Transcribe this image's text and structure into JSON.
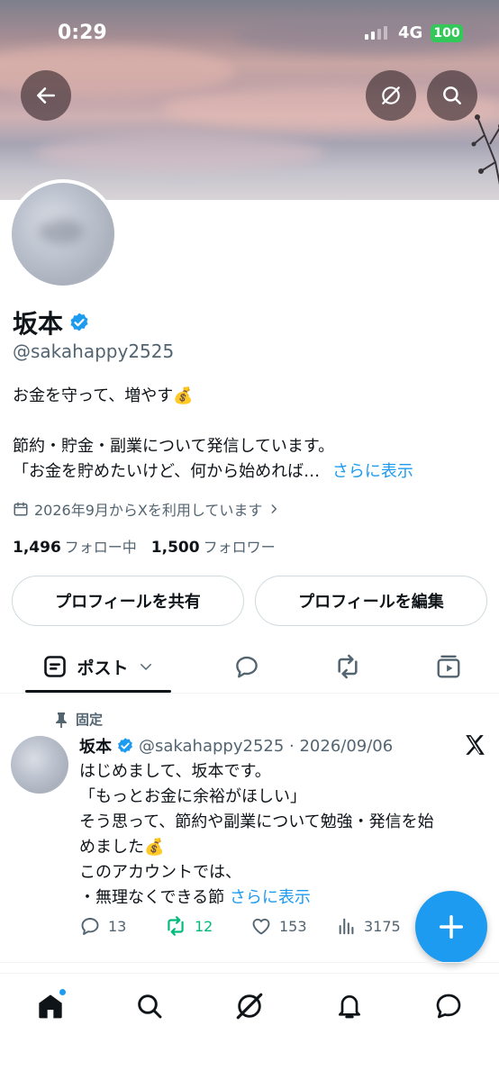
{
  "status_bar": {
    "time": "0:29",
    "network": "4G",
    "battery": "100"
  },
  "profile": {
    "name": "坂本",
    "handle": "@sakahappy2525",
    "bio_lines": [
      "お金を守って、増やす💰",
      "",
      "節約・貯金・副業について発信しています。"
    ],
    "bio_last": "「お金を貯めたいけど、何から始めれば…",
    "bio_more": "さらに表示",
    "joined": "2026年9月からXを利用しています",
    "following_count": "1,496",
    "following_label": "フォロー中",
    "followers_count": "1,500",
    "followers_label": "フォロワー"
  },
  "buttons": {
    "share": "プロフィールを共有",
    "edit": "プロフィールを編集"
  },
  "tabs": {
    "posts": "ポスト"
  },
  "post": {
    "pinned_label": "固定",
    "author": "坂本",
    "meta": "@sakahappy2525 · 2026/09/06",
    "lines": [
      "はじめまして、坂本です。",
      "「もっとお金に余裕がほしい」",
      "そう思って、節約や副業について勉強・発信を始",
      "めました💰",
      "このアカウントでは、"
    ],
    "last_line": "・無理なくできる節 ",
    "more": "さらに表示",
    "replies": "13",
    "reposts": "12",
    "likes": "153",
    "views": "3175"
  },
  "colors": {
    "accent": "#1d9bf0",
    "repost": "#00ba7c",
    "secondary_text": "#536471"
  },
  "icons": [
    "back-icon",
    "grok-icon",
    "search-icon",
    "verified-icon",
    "calendar-icon",
    "chevron-right-icon",
    "post-icon",
    "chevron-down-icon",
    "reply-icon",
    "repost-icon",
    "media-icon",
    "pin-icon",
    "x-logo-icon",
    "like-icon",
    "views-icon",
    "plus-icon",
    "home-icon",
    "bell-icon",
    "messages-icon"
  ]
}
